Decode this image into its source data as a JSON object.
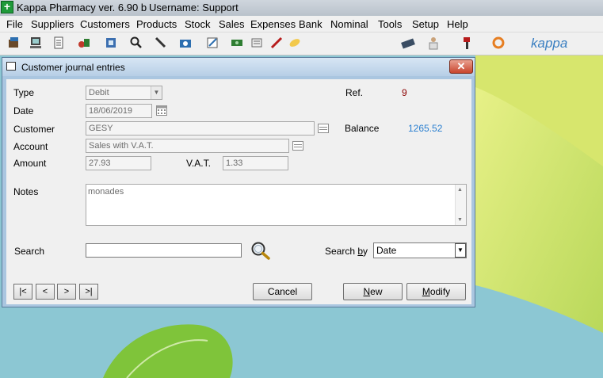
{
  "app": {
    "title": "Kappa Pharmacy ver. 6.90 b",
    "user": "Username: Support"
  },
  "menu": [
    "File",
    "Suppliers",
    "Customers",
    "Products",
    "Stock",
    "Sales",
    "Expenses",
    "Bank",
    "Nominal",
    "Tools",
    "Setup",
    "Help"
  ],
  "toolbar": {
    "logo": "kappa"
  },
  "dialog": {
    "title": "Customer journal entries",
    "close": "✕",
    "type_label": "Type",
    "type_value": "Debit",
    "date_label": "Date",
    "date_value": "18/06/2019",
    "customer_label": "Customer",
    "customer_value": "GESY",
    "account_label": "Account",
    "account_value": "Sales with V.A.T.",
    "amount_label": "Amount",
    "amount_value": "27.93",
    "vat_label": "V.A.T.",
    "vat_value": "1.33",
    "ref_label": "Ref.",
    "ref_value": "9",
    "balance_label": "Balance",
    "balance_value": "1265.52",
    "notes_label": "Notes",
    "notes_value": "monades",
    "search_label": "Search",
    "search_value": "",
    "searchby_label_pre": "Search ",
    "searchby_label_u": "b",
    "searchby_label_post": "y",
    "searchby_value": "Date",
    "nav": {
      "first": "|<",
      "prev": "<",
      "next": ">",
      "last": ">|"
    },
    "cancel": "Cancel",
    "new_u": "N",
    "new_rest": "ew",
    "modify_u": "M",
    "modify_rest": "odify"
  },
  "colors": {
    "ref": "#8b0000",
    "balance": "#2a7fd0",
    "close": "#c8452d"
  }
}
